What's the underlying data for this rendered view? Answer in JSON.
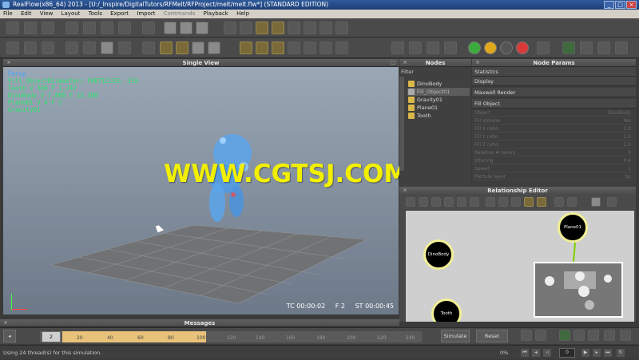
{
  "window": {
    "title": "RealFlow(x86_64) 2013 - [U:/_Inspire/DigitalTutors/RFMelt/RFProject/melt/melt.flw*] (STANDARD EDITION)",
    "minimize": "_",
    "maximize": "□",
    "close": "×"
  },
  "menu": [
    "File",
    "Edit",
    "View",
    "Layout",
    "Tools",
    "Export",
    "Import",
    "Commands",
    "Playback",
    "Help"
  ],
  "panels": {
    "single_view": "Single View",
    "nodes": "Nodes",
    "node_params": "Node Params",
    "relationship_editor": "Relationship Editor",
    "messages": "Messages"
  },
  "viewport": {
    "overlay_lines": [
      "Persp",
      "Fill_Object01(master) PARTICLES: 319",
      "Tooth V 380 F 1,742",
      "DinoBody V 7,880 F 15,308",
      "Plane01 V 4 F 2",
      "Gravity01"
    ],
    "hud": {
      "tc": "TC 00:00:02",
      "frame": "F 2",
      "st": "ST 00:00:45"
    }
  },
  "watermark": "WWW.CGTSJ.COM",
  "nodes": {
    "filter_label": "Filter",
    "items": [
      {
        "label": "DinoBody",
        "selected": false
      },
      {
        "label": "Fill_Object01",
        "selected": true
      },
      {
        "label": "Gravity01",
        "selected": false
      },
      {
        "label": "Plane01",
        "selected": false
      },
      {
        "label": "Tooth",
        "selected": false
      }
    ]
  },
  "params": {
    "sections": [
      "Statistics",
      "Display",
      "Maxwell Render",
      "Fill Object"
    ],
    "rows": [
      {
        "label": "Object",
        "value": "DinoBody"
      },
      {
        "label": "Fill Volume",
        "value": "Yes"
      },
      {
        "label": "Fill X ratio",
        "value": "1.0"
      },
      {
        "label": "Fill Y ratio",
        "value": "1.0"
      },
      {
        "label": "Fill Z ratio",
        "value": "1.0"
      },
      {
        "label": "Relative # layers",
        "value": "0"
      },
      {
        "label": "Jittering",
        "value": "0.4"
      },
      {
        "label": "Speed",
        "value": "1"
      },
      {
        "label": "Particle layer",
        "value": "Sp"
      }
    ]
  },
  "relationship": {
    "nodes": [
      "DinoBody",
      "Plane01",
      "Tooth"
    ]
  },
  "timeline": {
    "current_frame": "2",
    "ticks": [
      "20",
      "40",
      "60",
      "80",
      "100",
      "120",
      "140",
      "160",
      "180",
      "200",
      "220",
      "240"
    ],
    "simulate": "Simulate",
    "reset": "Reset",
    "progress": "0%",
    "frame_box": "0"
  },
  "status": "Using 24 thread(s) for this simulation."
}
